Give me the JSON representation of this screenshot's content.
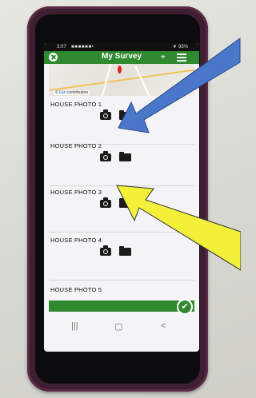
{
  "status_bar": {
    "time": "3:07",
    "icons": "■ ■ ■ ■ ■ ■ •",
    "battery": "▼ 95%"
  },
  "header": {
    "title": "My Survey"
  },
  "map": {
    "credit_prefix": "©",
    "credit_link": "Esri",
    "credit_suffix": "contributors"
  },
  "items": [
    {
      "label": "HOUSE PHOTO 1"
    },
    {
      "label": "HOUSE PHOTO 2"
    },
    {
      "label": "HOUSE PHOTO 3"
    },
    {
      "label": "HOUSE PHOTO 4"
    },
    {
      "label": "HOUSE PHOTO 5"
    }
  ],
  "icons": {
    "close": "close-icon",
    "map": "map-icon",
    "menu": "menu-icon",
    "camera": "camera-icon",
    "folder": "folder-icon",
    "submit": "checkmark-icon"
  },
  "navigation": {
    "recent": "|||",
    "home": "▢",
    "back": "<"
  },
  "colors": {
    "accent": "#2f8a2f",
    "blue_arrow": "#4a77c9",
    "yellow_arrow": "#f3f03a",
    "case": "#3e1f32"
  }
}
